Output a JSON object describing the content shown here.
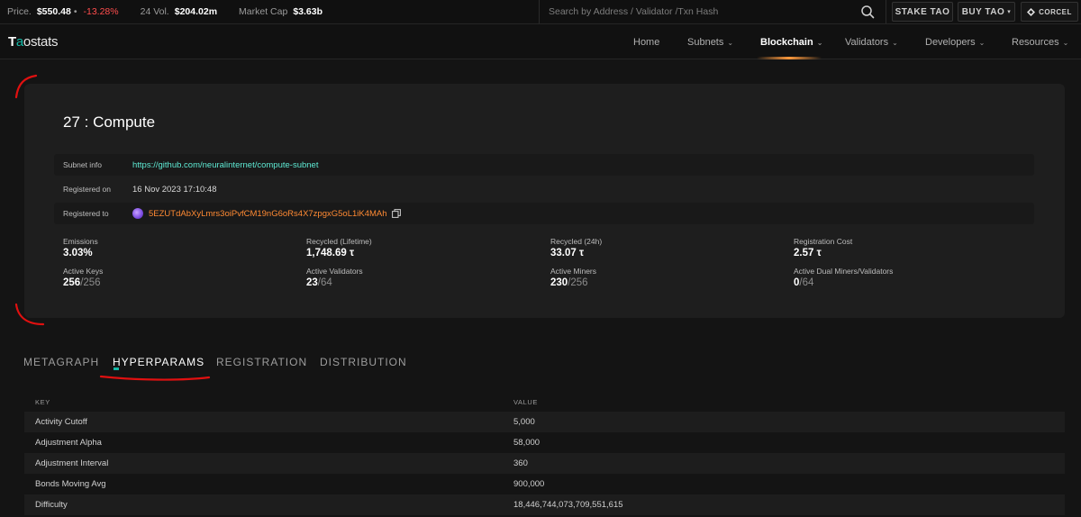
{
  "ticker": {
    "price_label": "Price.",
    "price_value": "$550.48",
    "price_dot": "•",
    "price_change": "-13.28%",
    "vol_label": "24 Vol.",
    "vol_value": "$204.02m",
    "mcap_label": "Market Cap",
    "mcap_value": "$3.63b",
    "search_placeholder": "Search by Address / Validator /Txn Hash",
    "stake_label": "STAKE TAO",
    "buy_label": "BUY TAO",
    "corcel_label": "CORCEL"
  },
  "nav": {
    "logo_first": "T",
    "logo_dot": "a",
    "logo_rest": "ostats",
    "items": [
      {
        "label": "Home",
        "chevron": ""
      },
      {
        "label": "Subnets",
        "chevron": "⌄"
      },
      {
        "label": "Blockchain",
        "chevron": "⌄"
      },
      {
        "label": "Validators",
        "chevron": "⌄"
      },
      {
        "label": "Developers",
        "chevron": "⌄"
      },
      {
        "label": "Resources",
        "chevron": "⌄"
      }
    ]
  },
  "subnet": {
    "title": "27 : Compute",
    "info": {
      "subnet_info_label": "Subnet info",
      "subnet_info_value": "https://github.com/neuralinternet/compute-subnet",
      "registered_on_label": "Registered on",
      "registered_on_value": "16 Nov 2023 17:10:48",
      "registered_to_label": "Registered to",
      "registered_to_value": "5EZUTdAbXyLmrs3oiPvfCM19nG6oRs4X7zpgxG5oL1iK4MAh"
    },
    "stats": {
      "emissions_label": "Emissions",
      "emissions_value": "3.03%",
      "recycled_lifetime_label": "Recycled (Lifetime)",
      "recycled_lifetime_value": "1,748.69 τ",
      "recycled_24h_label": "Recycled (24h)",
      "recycled_24h_value": "33.07 τ",
      "registration_cost_label": "Registration Cost",
      "registration_cost_value": "2.57 τ",
      "active_keys_label": "Active Keys",
      "active_keys_value": "256",
      "active_keys_total": "/256",
      "active_validators_label": "Active Validators",
      "active_validators_value": "23",
      "active_validators_total": "/64",
      "active_miners_label": "Active Miners",
      "active_miners_value": "230",
      "active_miners_total": "/256",
      "active_dual_label": "Active Dual Miners/Validators",
      "active_dual_value": "0",
      "active_dual_total": "/64"
    }
  },
  "tabs": [
    {
      "label": "METAGRAPH"
    },
    {
      "label": "HYPERPARAMS"
    },
    {
      "label": "REGISTRATION"
    },
    {
      "label": "DISTRIBUTION"
    }
  ],
  "hyperparams": {
    "key_header": "KEY",
    "value_header": "VALUE",
    "rows": [
      {
        "key": "Activity Cutoff",
        "value": "5,000"
      },
      {
        "key": "Adjustment Alpha",
        "value": "58,000"
      },
      {
        "key": "Adjustment Interval",
        "value": "360"
      },
      {
        "key": "Bonds Moving Avg",
        "value": "900,000"
      },
      {
        "key": "Difficulty",
        "value": "18,446,744,073,709,551,615"
      }
    ]
  },
  "colors": {
    "accent_teal": "#14b8a6",
    "link_teal": "#5eead4",
    "address_orange": "#ff8a33",
    "negative_red": "#ff4d4d",
    "annotation_red": "#e01010"
  }
}
